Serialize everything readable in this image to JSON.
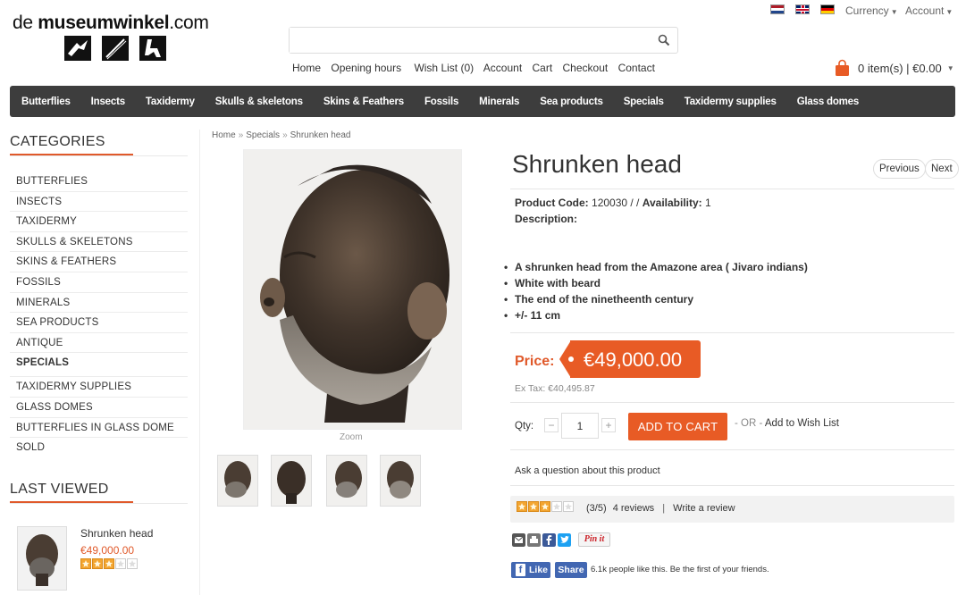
{
  "header": {
    "logo_prefix": "de ",
    "logo_bold": "museumwinkel",
    "logo_suffix": ".com",
    "currency_label": "Currency",
    "account_label": "Account",
    "search_placeholder": "",
    "top_links": [
      "Home",
      "Opening hours",
      "Wish List (0)",
      "Account",
      "Cart",
      "Checkout",
      "Contact"
    ],
    "cart_summary": "0 item(s) | €0.00"
  },
  "nav": {
    "items": [
      "Butterflies",
      "Insects",
      "Taxidermy",
      "Skulls & skeletons",
      "Skins & Feathers",
      "Fossils",
      "Minerals",
      "Sea products",
      "Specials",
      "Taxidermy supplies",
      "Glass domes"
    ]
  },
  "sidebar": {
    "categories_title": "CATEGORIES",
    "categories": [
      {
        "label": "BUTTERFLIES"
      },
      {
        "label": "INSECTS"
      },
      {
        "label": "TAXIDERMY"
      },
      {
        "label": "SKULLS & SKELETONS"
      },
      {
        "label": "SKINS & FEATHERS"
      },
      {
        "label": "FOSSILS"
      },
      {
        "label": "MINERALS"
      },
      {
        "label": "SEA PRODUCTS"
      },
      {
        "label": "ANTIQUE"
      },
      {
        "label": "SPECIALS",
        "active": true
      },
      {
        "label": "TAXIDERMY SUPPLIES"
      },
      {
        "label": "GLASS DOMES"
      },
      {
        "label": "BUTTERFLIES IN GLASS DOME"
      },
      {
        "label": "SOLD"
      }
    ],
    "last_viewed_title": "LAST VIEWED",
    "last_viewed": {
      "name": "Shrunken head",
      "price": "€49,000.00",
      "rating": 3
    }
  },
  "breadcrumb": [
    "Home",
    "Specials",
    "Shrunken head"
  ],
  "product": {
    "title": "Shrunken head",
    "prev_label": "Previous",
    "next_label": "Next",
    "code_label": "Product Code:",
    "code_value": "120030 / /",
    "availability_label": "Availability:",
    "availability_value": "1",
    "description_label": "Description:",
    "bullets": [
      "A shrunken head from the Amazone area ( Jivaro indians)",
      "White with beard",
      "The end of the ninetheenth century",
      "+/- 11 cm"
    ],
    "zoom_label": "Zoom",
    "price_label": "Price:",
    "price": "€49,000.00",
    "ex_tax": "Ex Tax: €40,495.87",
    "qty_label": "Qty:",
    "qty_value": "1",
    "add_to_cart": "ADD TO CART",
    "or_label": "- OR -",
    "wishlist_label": "Add to Wish List",
    "ask_label": "Ask a question about this product",
    "rating": 3,
    "rating_text": "(3/5)",
    "reviews_label": "4 reviews",
    "write_review_label": "Write a review",
    "pin_label": "Pin it",
    "fb_like_label": "Like",
    "fb_share_label": "Share",
    "fb_text": "6.1k people like this. Be the first of your friends."
  },
  "colors": {
    "accent": "#e85b25",
    "nav_bg": "#3d3d3d",
    "facebook": "#4267b2"
  }
}
